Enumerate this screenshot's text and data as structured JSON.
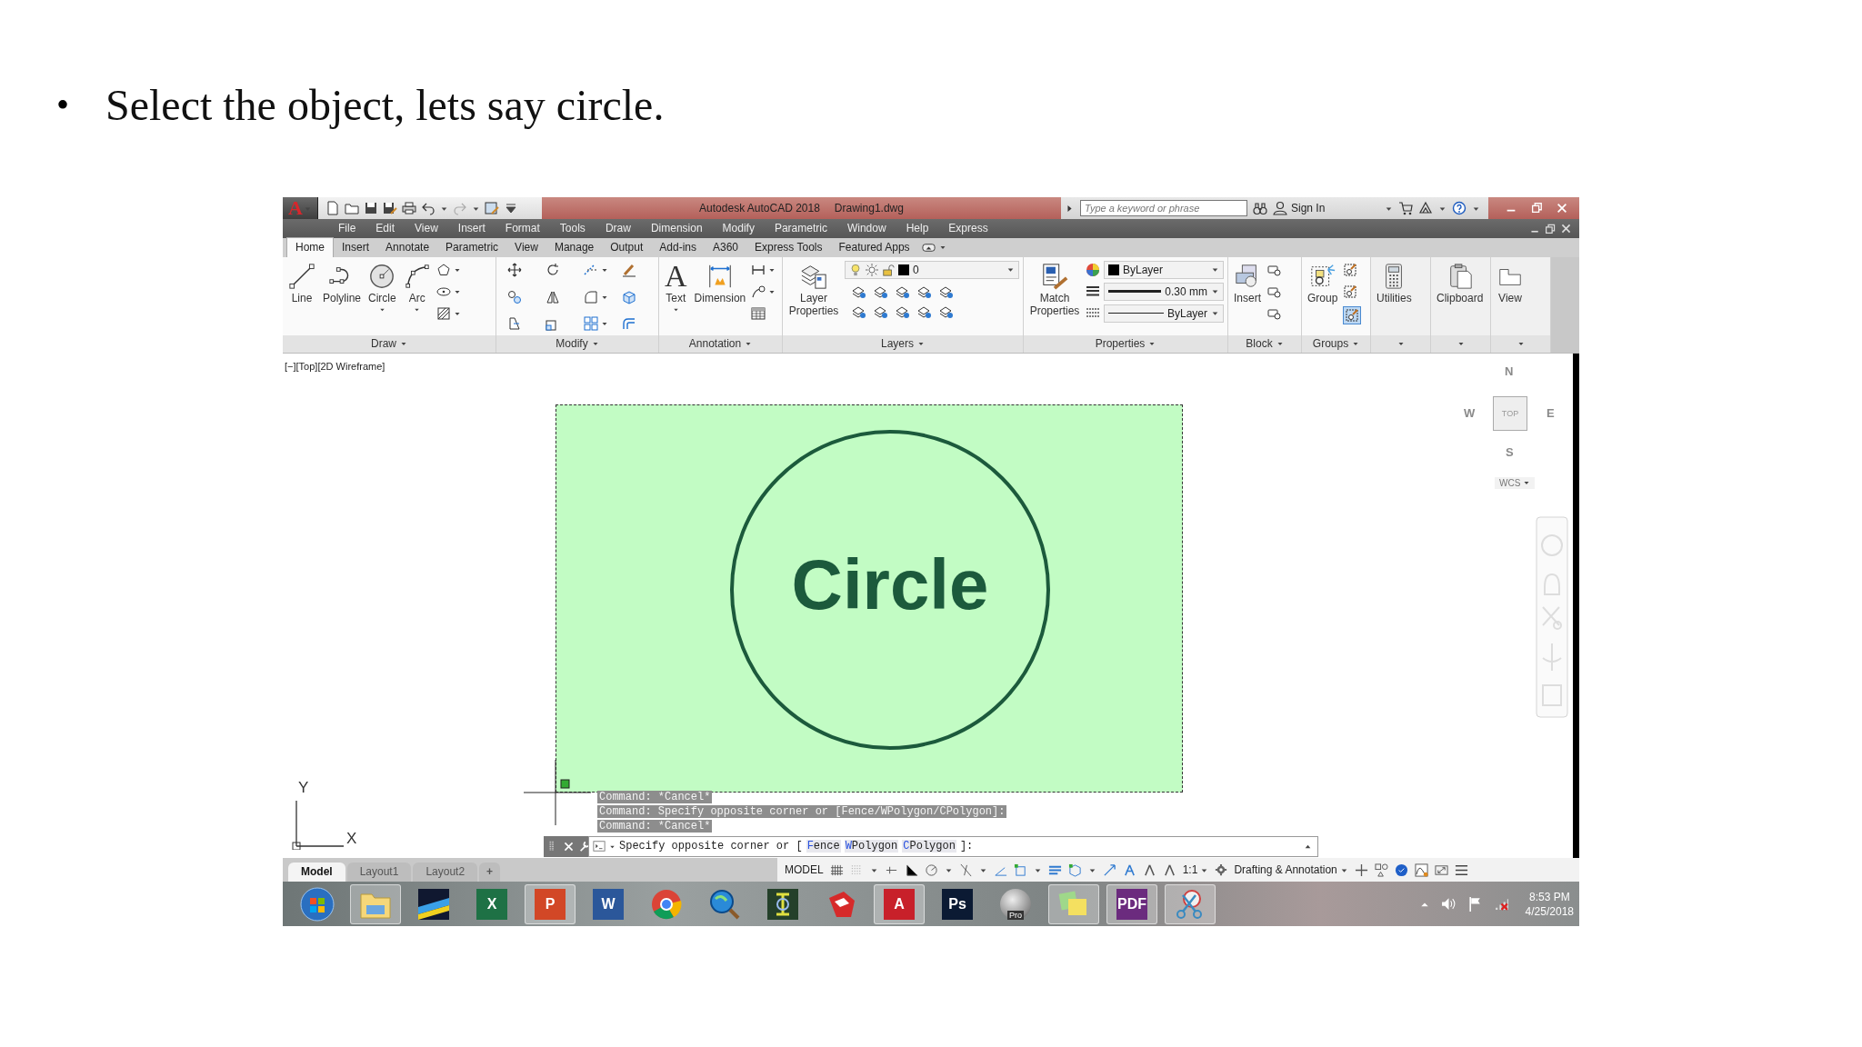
{
  "slide": {
    "bullet": "•",
    "text": "Select the object, lets say circle."
  },
  "app": {
    "logo": "A",
    "title": "Autodesk AutoCAD 2018",
    "document": "Drawing1.dwg",
    "search": {
      "placeholder": "Type a keyword or phrase"
    },
    "sign_in": "Sign In"
  },
  "menu": [
    "File",
    "Edit",
    "View",
    "Insert",
    "Format",
    "Tools",
    "Draw",
    "Dimension",
    "Modify",
    "Parametric",
    "Window",
    "Help",
    "Express"
  ],
  "ribbon_tabs": [
    {
      "label": "Home",
      "selected": true
    },
    {
      "label": "Insert",
      "selected": false
    },
    {
      "label": "Annotate",
      "selected": false
    },
    {
      "label": "Parametric",
      "selected": false
    },
    {
      "label": "View",
      "selected": false
    },
    {
      "label": "Manage",
      "selected": false
    },
    {
      "label": "Output",
      "selected": false
    },
    {
      "label": "Add-ins",
      "selected": false
    },
    {
      "label": "A360",
      "selected": false
    },
    {
      "label": "Express Tools",
      "selected": false
    },
    {
      "label": "Featured Apps",
      "selected": false
    }
  ],
  "ribbon": {
    "draw": {
      "title": "Draw",
      "tools": [
        {
          "label": "Line",
          "dropdown": false
        },
        {
          "label": "Polyline",
          "dropdown": false
        },
        {
          "label": "Circle",
          "dropdown": true
        },
        {
          "label": "Arc",
          "dropdown": true
        }
      ]
    },
    "modify": {
      "title": "Modify"
    },
    "annotation": {
      "title": "Annotation",
      "text_glyph": "A",
      "tools": [
        {
          "label": "Text",
          "dropdown": true
        },
        {
          "label": "Dimension",
          "dropdown": false
        }
      ]
    },
    "layers": {
      "title": "Layers",
      "tool": "Layer Properties",
      "current_layer": "0"
    },
    "properties": {
      "title": "Properties",
      "tool": "Match Properties",
      "color_setting": "ByLayer",
      "lineweight": "0.30 mm",
      "linetype": "ByLayer"
    },
    "block": {
      "title": "Block",
      "tool": "Insert"
    },
    "groups": {
      "title": "Groups",
      "tool": "Group",
      "selection_on": true
    },
    "extras": [
      {
        "label": "Utilities"
      },
      {
        "label": "Clipboard"
      },
      {
        "label": "View"
      }
    ]
  },
  "viewport": {
    "label": "[−][Top][2D Wireframe]",
    "drawing_text": "Circle"
  },
  "viewcube": {
    "north": "N",
    "west": "W",
    "east": "E",
    "south": "S",
    "face": "TOP",
    "ucs": "WCS"
  },
  "ucs_axes": {
    "y": "Y",
    "x": "X"
  },
  "command_history": [
    "Command: *Cancel*",
    "Command: Specify opposite corner or [Fence/WPolygon/CPolygon]:",
    "Command: *Cancel*"
  ],
  "command_line": {
    "prompt": "Specify opposite corner or [",
    "options": [
      {
        "key": "F",
        "rest": "ence"
      },
      {
        "key": "W",
        "rest": "Polygon"
      },
      {
        "key": "C",
        "rest": "Polygon"
      }
    ],
    "end": "]:"
  },
  "layout_tabs": [
    {
      "label": "Model",
      "selected": true
    },
    {
      "label": "Layout1",
      "selected": false
    },
    {
      "label": "Layout2",
      "selected": false
    }
  ],
  "add_layout": "+",
  "status": {
    "space": "MODEL",
    "scale": "1:1",
    "workspace": "Drafting & Annotation"
  },
  "taskbar": {
    "apps": [
      {
        "kind": "start",
        "running": false
      },
      {
        "kind": "folder",
        "running": true
      },
      {
        "kind": "stripes",
        "running": false
      },
      {
        "kind": "tile",
        "glyph": "X",
        "color": "#1e7145",
        "running": false
      },
      {
        "kind": "tile",
        "glyph": "P",
        "color": "#d24726",
        "running": true
      },
      {
        "kind": "tile",
        "glyph": "W",
        "color": "#2b579a",
        "running": false
      },
      {
        "kind": "chrome",
        "running": false
      },
      {
        "kind": "globe",
        "running": false
      },
      {
        "kind": "mark",
        "running": false
      },
      {
        "kind": "cube",
        "running": false
      },
      {
        "kind": "tile",
        "glyph": "A",
        "color": "#c8202a",
        "running": true
      },
      {
        "kind": "tile",
        "glyph": "Ps",
        "color": "#0b1a33",
        "running": false
      },
      {
        "kind": "sphere",
        "glyph": "Pro",
        "running": false
      },
      {
        "kind": "sticky",
        "running": true
      },
      {
        "kind": "tile",
        "glyph": "PDF",
        "color": "#6b2b7e",
        "running": true
      },
      {
        "kind": "snip",
        "running": true
      }
    ],
    "time": "8:53 PM",
    "date": "4/25/2018"
  }
}
